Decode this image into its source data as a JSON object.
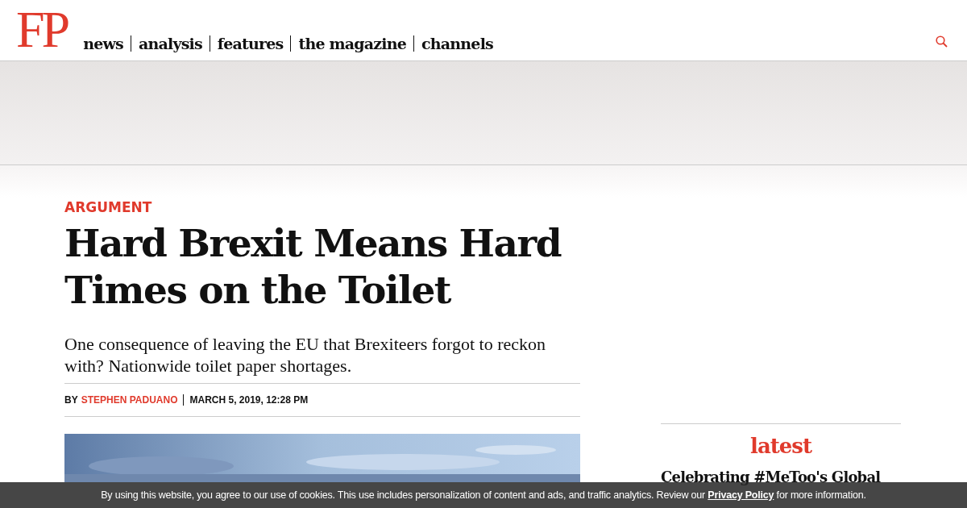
{
  "header": {
    "logo": "FP",
    "nav": [
      {
        "label": "news"
      },
      {
        "label": "analysis"
      },
      {
        "label": "features"
      },
      {
        "label": "the magazine"
      },
      {
        "label": "channels"
      }
    ]
  },
  "article": {
    "category": "ARGUMENT",
    "title": "Hard Brexit Means Hard Times on the Toilet",
    "dek": "One consequence of leaving the EU that Brexiteers forgot to reckon with? Nationwide toilet paper shortages.",
    "byline": {
      "prefix": "BY",
      "author": "STEPHEN PADUANO",
      "date": "MARCH 5, 2019, 12:28 PM"
    }
  },
  "sidebar": {
    "heading": "latest",
    "items": [
      {
        "title": "Celebrating #MeToo's Global"
      }
    ]
  },
  "cookie_banner": {
    "text_before": "By using this website, you agree to our use of cookies. This use includes personalization of content and ads, and traffic analytics. Review our",
    "link": "Privacy Policy",
    "text_after": "for more information."
  }
}
